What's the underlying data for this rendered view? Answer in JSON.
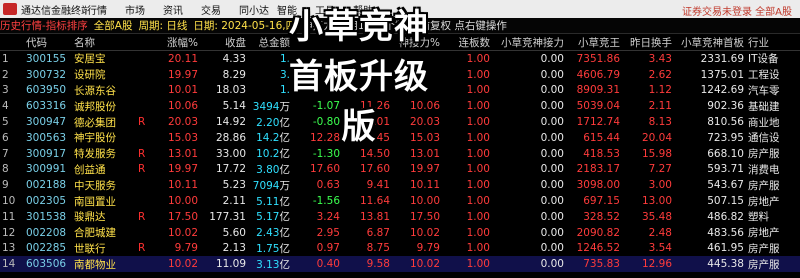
{
  "menubar": {
    "app_name": "通达信金融终端",
    "menus": [
      "行情",
      "市场",
      "资讯",
      "交易",
      "同小达",
      "智能",
      "工具",
      "帮助"
    ],
    "right_text": "证券交易未登录  全部A股"
  },
  "title_bar": {
    "app": "历史行情-指标排序",
    "scope": "全部A股",
    "period": "周期: 日线",
    "date": "日期: 2024-05-16,四",
    "rest": "神接力  使用1000个数据 前复权 点右键操作"
  },
  "overlay": {
    "line1": "小草竞神",
    "line2": "首板升级版"
  },
  "colors": {
    "up": "#ff3b3b",
    "down": "#3bff4f",
    "amount": "#2fe0ff",
    "name": "#ffe14a"
  },
  "columns": [
    "",
    "代码",
    "名称",
    "",
    "涨幅%",
    "收盘",
    "总金额",
    "",
    "",
    "神接力%",
    "连板数",
    "小草竞神接力",
    "小草竞王",
    "昨日换手",
    "小草竞神首板",
    "行业"
  ],
  "rows": [
    {
      "idx": "1",
      "code": "300155",
      "name": "安居宝",
      "flag": "",
      "pct": "20.11",
      "close": "4.33",
      "amt": "1.",
      "unit": "",
      "c7": "",
      "c8": "",
      "c9": "",
      "lb": "1.00",
      "jl": "0.00",
      "jw": "7351.86",
      "hs": "3.43",
      "sb": "2331.69",
      "ind": "IT设备"
    },
    {
      "idx": "2",
      "code": "300732",
      "name": "设研院",
      "flag": "",
      "pct": "19.97",
      "close": "8.29",
      "amt": "3.",
      "unit": "",
      "c7": "",
      "c8": "",
      "c9": "",
      "lb": "1.00",
      "jl": "0.00",
      "jw": "4606.79",
      "hs": "2.62",
      "sb": "1375.01",
      "ind": "工程设"
    },
    {
      "idx": "3",
      "code": "603950",
      "name": "长源东谷",
      "flag": "",
      "pct": "10.01",
      "close": "18.03",
      "amt": "1.",
      "unit": "",
      "c7": "",
      "c8": "",
      "c9": "",
      "lb": "1.00",
      "jl": "0.00",
      "jw": "8909.31",
      "hs": "1.12",
      "sb": "1242.69",
      "ind": "汽车零"
    },
    {
      "idx": "4",
      "code": "603316",
      "name": "诚邦股份",
      "flag": "",
      "pct": "10.06",
      "close": "5.14",
      "amt": "3494",
      "unit": "万",
      "c7": "-1.07",
      "c8": "11.26",
      "c9": "10.06",
      "lb": "1.00",
      "jl": "0.00",
      "jw": "5039.04",
      "hs": "2.11",
      "sb": "902.36",
      "ind": "基础建"
    },
    {
      "idx": "5",
      "code": "300947",
      "name": "德必集团",
      "flag": "R",
      "pct": "20.03",
      "close": "14.92",
      "amt": "2.20",
      "unit": "亿",
      "c7": "-0.80",
      "c8": "21.01",
      "c9": "20.03",
      "lb": "1.00",
      "jl": "0.00",
      "jw": "1712.74",
      "hs": "8.13",
      "sb": "810.56",
      "ind": "商业地"
    },
    {
      "idx": "6",
      "code": "300563",
      "name": "神宇股份",
      "flag": "",
      "pct": "15.03",
      "close": "28.86",
      "amt": "14.2",
      "unit": "亿",
      "c7": "12.28",
      "c8": "2.45",
      "c9": "15.03",
      "lb": "1.00",
      "jl": "0.00",
      "jw": "615.44",
      "hs": "20.04",
      "sb": "723.95",
      "ind": "通信设"
    },
    {
      "idx": "7",
      "code": "300917",
      "name": "特发服务",
      "flag": "R",
      "pct": "13.01",
      "close": "33.00",
      "amt": "10.2",
      "unit": "亿",
      "c7": "-1.30",
      "c8": "14.50",
      "c9": "13.01",
      "lb": "1.00",
      "jl": "0.00",
      "jw": "418.53",
      "hs": "15.98",
      "sb": "668.10",
      "ind": "房产服"
    },
    {
      "idx": "8",
      "code": "300991",
      "name": "创益通",
      "flag": "R",
      "pct": "19.97",
      "close": "17.72",
      "amt": "3.80",
      "unit": "亿",
      "c7": "17.60",
      "c8": "17.60",
      "c9": "19.97",
      "lb": "1.00",
      "jl": "0.00",
      "jw": "2183.17",
      "hs": "7.27",
      "sb": "593.71",
      "ind": "消费电"
    },
    {
      "idx": "9",
      "code": "002188",
      "name": "中天服务",
      "flag": "",
      "pct": "10.11",
      "close": "5.23",
      "amt": "7094",
      "unit": "万",
      "c7": "0.63",
      "c8": "9.41",
      "c9": "10.11",
      "lb": "1.00",
      "jl": "0.00",
      "jw": "3098.00",
      "hs": "3.00",
      "sb": "543.67",
      "ind": "房产服"
    },
    {
      "idx": "10",
      "code": "002305",
      "name": "南国置业",
      "flag": "",
      "pct": "10.00",
      "close": "2.11",
      "amt": "5.11",
      "unit": "亿",
      "c7": "-1.56",
      "c8": "11.64",
      "c9": "10.00",
      "lb": "1.00",
      "jl": "0.00",
      "jw": "697.15",
      "hs": "13.00",
      "sb": "507.15",
      "ind": "房地产"
    },
    {
      "idx": "11",
      "code": "301538",
      "name": "骏鼎达",
      "flag": "R",
      "pct": "17.50",
      "close": "177.31",
      "amt": "5.17",
      "unit": "亿",
      "c7": "3.24",
      "c8": "13.81",
      "c9": "17.50",
      "lb": "1.00",
      "jl": "0.00",
      "jw": "328.52",
      "hs": "35.48",
      "sb": "486.82",
      "ind": "塑料"
    },
    {
      "idx": "12",
      "code": "002208",
      "name": "合肥城建",
      "flag": "",
      "pct": "10.02",
      "close": "5.60",
      "amt": "2.43",
      "unit": "亿",
      "c7": "2.95",
      "c8": "6.87",
      "c9": "10.02",
      "lb": "1.00",
      "jl": "0.00",
      "jw": "2090.82",
      "hs": "2.48",
      "sb": "483.56",
      "ind": "房地产"
    },
    {
      "idx": "13",
      "code": "002285",
      "name": "世联行",
      "flag": "R",
      "pct": "9.79",
      "close": "2.13",
      "amt": "1.75",
      "unit": "亿",
      "c7": "0.97",
      "c8": "8.75",
      "c9": "9.79",
      "lb": "1.00",
      "jl": "0.00",
      "jw": "1246.52",
      "hs": "3.54",
      "sb": "461.95",
      "ind": "房产服"
    },
    {
      "idx": "14",
      "code": "603506",
      "name": "南都物业",
      "flag": "",
      "pct": "10.02",
      "close": "11.09",
      "amt": "3.13",
      "unit": "亿",
      "c7": "0.40",
      "c8": "9.58",
      "c9": "10.02",
      "lb": "1.00",
      "jl": "0.00",
      "jw": "735.83",
      "hs": "12.96",
      "sb": "445.38",
      "ind": "房产服"
    }
  ]
}
